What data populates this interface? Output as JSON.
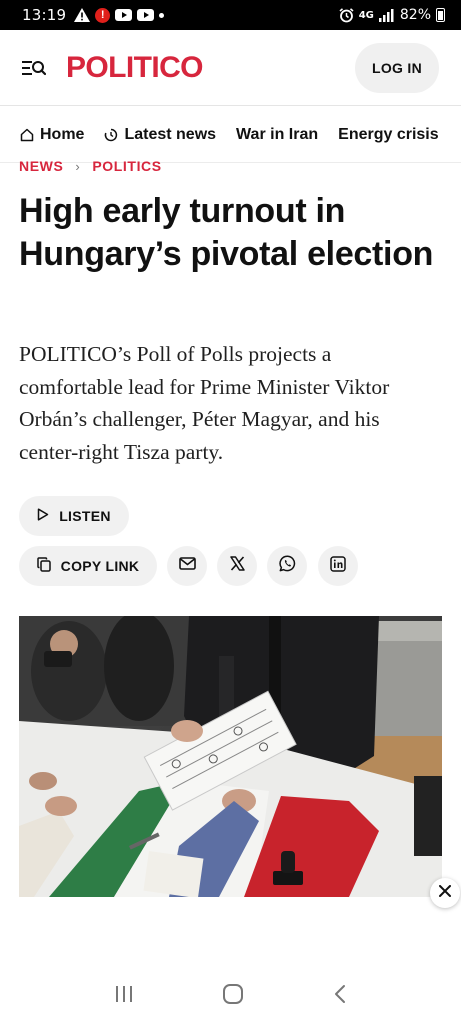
{
  "status_bar": {
    "time": "13:19",
    "network": "4G",
    "battery": "82%",
    "left_icons": [
      "warning-icon",
      "alert-icon",
      "youtube-icon",
      "youtube-icon",
      "dot-icon"
    ],
    "right_icons": [
      "alarm-icon",
      "signal-icon",
      "battery-icon"
    ]
  },
  "header": {
    "brand": "POLITICO",
    "login_label": "LOG IN",
    "menu_icon": "menu-search-icon"
  },
  "nav": {
    "items": [
      {
        "label": "Home",
        "icon": "home-icon"
      },
      {
        "label": "Latest news",
        "icon": "clock-icon"
      },
      {
        "label": "War in Iran"
      },
      {
        "label": "Energy crisis"
      }
    ]
  },
  "breadcrumb": {
    "section": "NEWS",
    "subsection": "POLITICS",
    "separator": "›"
  },
  "article": {
    "headline": "High early turnout in Hungary’s pivotal election",
    "dek": "POLITICO’s Poll of Polls projects a comfortable lead for Prime Minister Viktor Orbán’s challenger, Péter Magyar, and his center-right Tisza party."
  },
  "actions": {
    "listen_label": "LISTEN",
    "copy_link_label": "COPY LINK",
    "share_icons": [
      "mail-icon",
      "x-icon",
      "whatsapp-icon",
      "linkedin-icon"
    ]
  },
  "colors": {
    "brand_red": "#d7263d",
    "pill_bg": "#f1f1f1",
    "text": "#111111"
  }
}
